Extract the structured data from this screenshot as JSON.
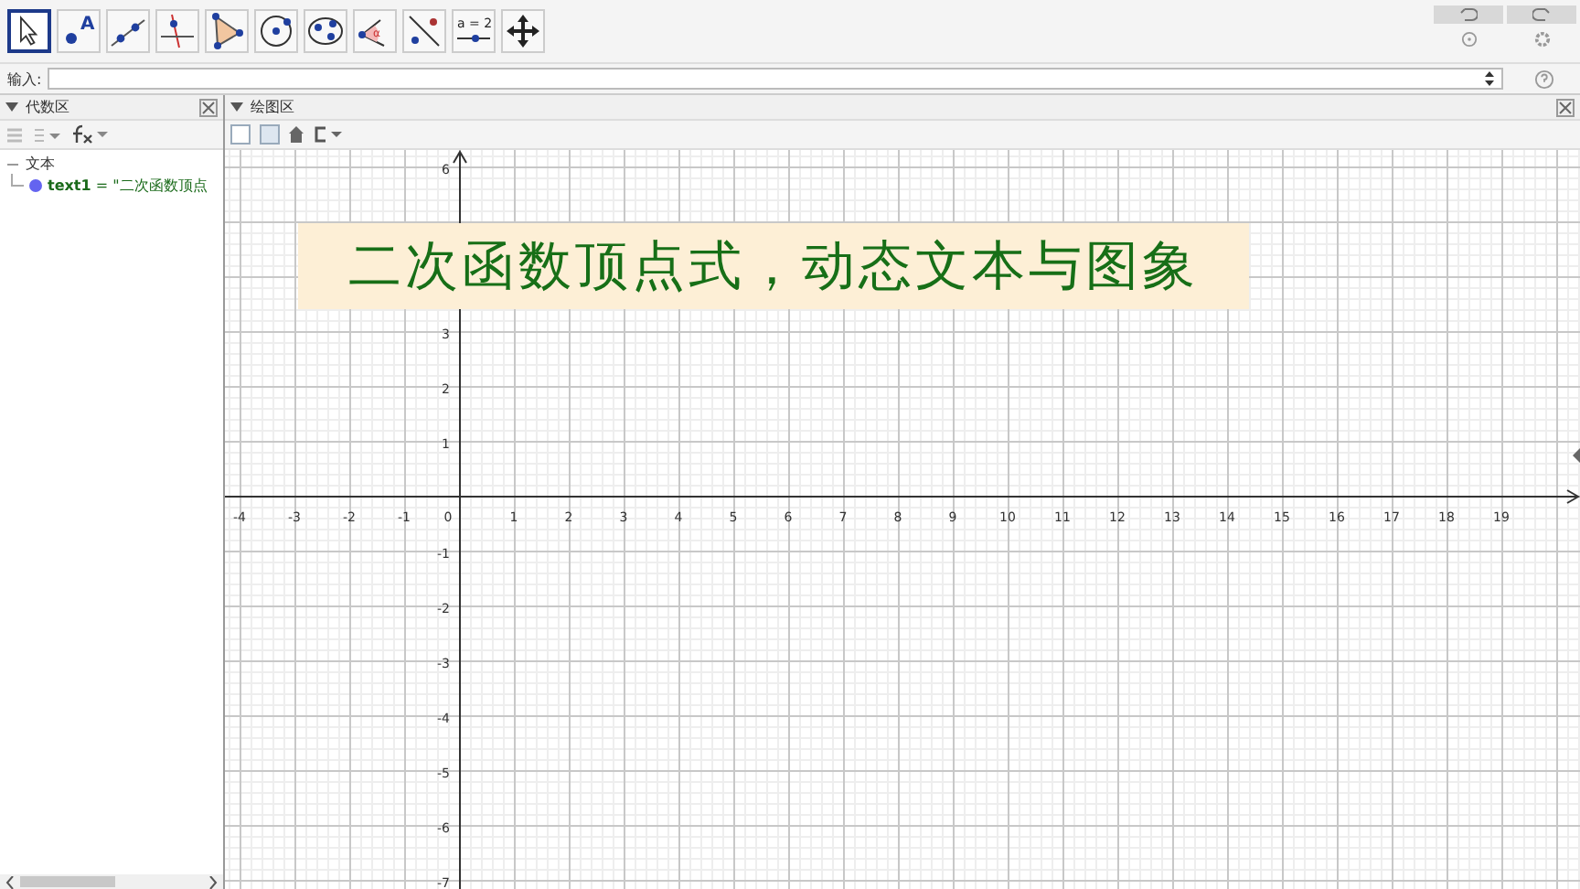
{
  "toolbar": {
    "tools": [
      {
        "kind": "move",
        "selected": true
      },
      {
        "kind": "point",
        "text": "A",
        "selected": false
      },
      {
        "kind": "line",
        "selected": false
      },
      {
        "kind": "perpendicular",
        "selected": false
      },
      {
        "kind": "polygon",
        "selected": false
      },
      {
        "kind": "circle",
        "selected": false
      },
      {
        "kind": "conic",
        "selected": false
      },
      {
        "kind": "angle",
        "text": "α",
        "selected": false
      },
      {
        "kind": "reflect",
        "selected": false
      },
      {
        "kind": "slider",
        "text": "a = 2",
        "selected": false
      },
      {
        "kind": "move-view",
        "selected": false
      }
    ]
  },
  "input_bar": {
    "label": "输入:"
  },
  "algebra_view": {
    "title": "代数区",
    "tree": [
      {
        "label": "文本",
        "expanded": true,
        "children": [
          {
            "text": "**text1** = \"二次函数顶点",
            "color": "#6464f0"
          }
        ]
      }
    ]
  },
  "graphics_view": {
    "title": "绘图区",
    "x_labels": [
      "-4",
      "-3",
      "-2",
      "-1",
      "0",
      "1",
      "2",
      "3",
      "4",
      "5",
      "6",
      "7",
      "8",
      "9",
      "10",
      "11",
      "12",
      "13",
      "14",
      "15",
      "16",
      "17",
      "18",
      "19"
    ],
    "y_labels": [
      "6",
      "3",
      "2",
      "1",
      "-1",
      "-2",
      "-3",
      "-4",
      "-5",
      "-6",
      "-7"
    ],
    "text_box": "二次函数顶点式，动态文本与图象"
  }
}
